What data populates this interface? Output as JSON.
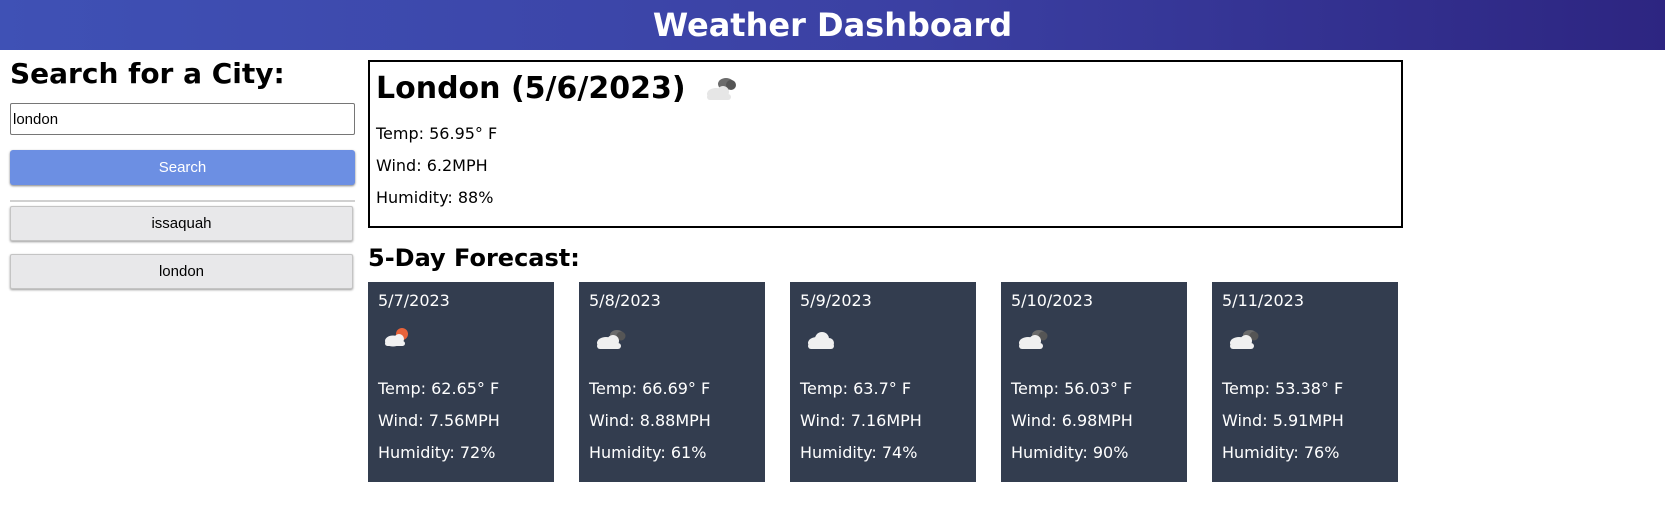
{
  "header": {
    "title": "Weather Dashboard"
  },
  "search": {
    "heading": "Search for a City:",
    "input_value": "london",
    "button_label": "Search"
  },
  "history": [
    {
      "label": "issaquah"
    },
    {
      "label": "london"
    }
  ],
  "current": {
    "title": "London (5/6/2023)",
    "icon": "broken-clouds-icon",
    "temp": "Temp: 56.95° F",
    "wind": "Wind: 6.2MPH",
    "humidity": "Humidity: 88%"
  },
  "forecast": {
    "title": "5-Day Forecast:",
    "days": [
      {
        "date": "5/7/2023",
        "icon": "few-clouds-icon",
        "temp": "Temp: 62.65° F",
        "wind": "Wind: 7.56MPH",
        "humidity": "Humidity: 72%"
      },
      {
        "date": "5/8/2023",
        "icon": "broken-clouds-icon",
        "temp": "Temp: 66.69° F",
        "wind": "Wind: 8.88MPH",
        "humidity": "Humidity: 61%"
      },
      {
        "date": "5/9/2023",
        "icon": "scattered-clouds-icon",
        "temp": "Temp: 63.7° F",
        "wind": "Wind: 7.16MPH",
        "humidity": "Humidity: 74%"
      },
      {
        "date": "5/10/2023",
        "icon": "broken-clouds-icon",
        "temp": "Temp: 56.03° F",
        "wind": "Wind: 6.98MPH",
        "humidity": "Humidity: 90%"
      },
      {
        "date": "5/11/2023",
        "icon": "broken-clouds-icon",
        "temp": "Temp: 53.38° F",
        "wind": "Wind: 5.91MPH",
        "humidity": "Humidity: 76%"
      }
    ]
  },
  "colors": {
    "header_start": "#3f51b5",
    "header_end": "#2d2581",
    "search_button": "#6c8fe3",
    "card_background": "#333d4f",
    "sun": "#e8633a"
  }
}
